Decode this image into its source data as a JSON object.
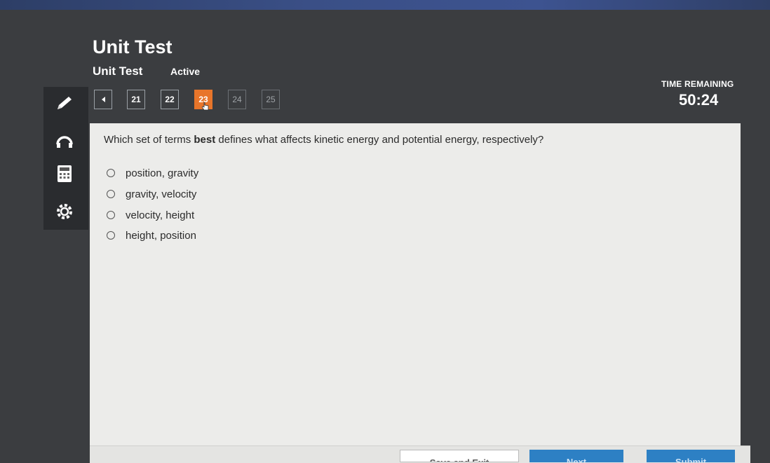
{
  "header": {
    "title": "Unit Test",
    "subtitle": "Unit Test",
    "status": "Active"
  },
  "timer": {
    "label": "TIME REMAINING",
    "value": "50:24"
  },
  "question_nav": {
    "items": [
      {
        "label": "21",
        "state": "visited"
      },
      {
        "label": "22",
        "state": "visited"
      },
      {
        "label": "23",
        "state": "current"
      },
      {
        "label": "24",
        "state": "unvisited"
      },
      {
        "label": "25",
        "state": "unvisited"
      }
    ]
  },
  "tools": [
    "pencil-icon",
    "headphones-icon",
    "calculator-icon",
    "settings-icon"
  ],
  "question": {
    "prefix": "Which set of terms ",
    "emphasis": "best",
    "suffix": " defines what affects kinetic energy and potential energy, respectively?",
    "options": [
      "position, gravity",
      "gravity, velocity",
      "velocity, height",
      "height, position"
    ]
  },
  "footer": {
    "save_label": "Save and Exit",
    "next_label": "Next",
    "submit_label": "Submit"
  },
  "colors": {
    "accent": "#e8752a",
    "primary_button": "#2d80c4",
    "background": "#3b3d40"
  }
}
